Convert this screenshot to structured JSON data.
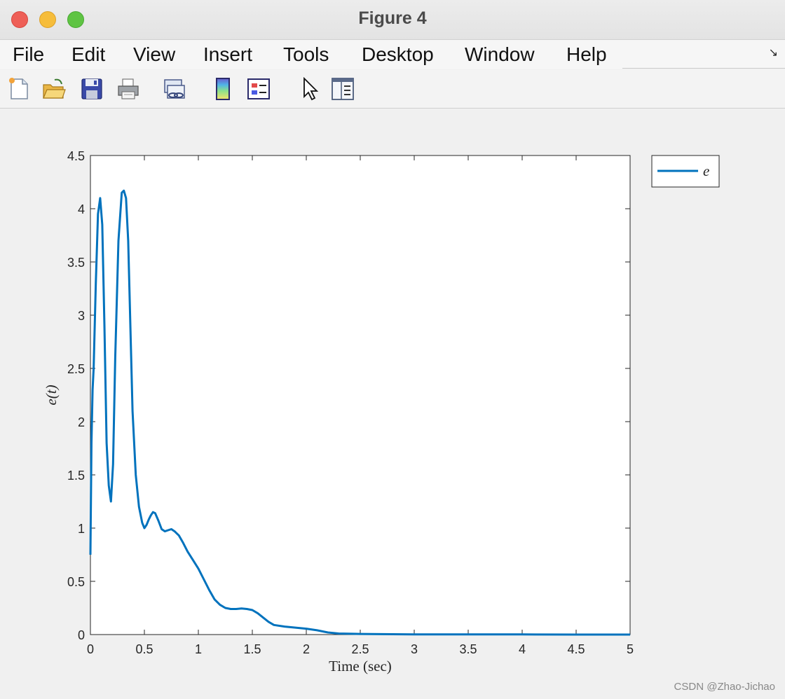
{
  "window": {
    "title": "Figure 4"
  },
  "menu": {
    "items": [
      {
        "label": "File",
        "x": 18
      },
      {
        "label": "Edit",
        "x": 102
      },
      {
        "label": "View",
        "x": 190
      },
      {
        "label": "Insert",
        "x": 290
      },
      {
        "label": "Tools",
        "x": 404
      },
      {
        "label": "Desktop",
        "x": 516
      },
      {
        "label": "Window",
        "x": 663
      },
      {
        "label": "Help",
        "x": 808
      }
    ]
  },
  "toolbar": {
    "buttons": [
      {
        "name": "new-figure-icon",
        "x": 10
      },
      {
        "name": "open-file-icon",
        "x": 60
      },
      {
        "name": "save-icon",
        "x": 114
      },
      {
        "name": "print-icon",
        "x": 166
      },
      {
        "name": "link-plot-icon",
        "x": 232
      },
      {
        "name": "insert-colorbar-icon",
        "x": 302
      },
      {
        "name": "insert-legend-icon",
        "x": 352
      },
      {
        "name": "edit-plot-pointer-icon",
        "x": 426
      },
      {
        "name": "property-inspector-icon",
        "x": 472
      }
    ]
  },
  "watermark": "CSDN @Zhao-Jichao",
  "chart_data": {
    "type": "line",
    "title": "",
    "xlabel": "Time (sec)",
    "ylabel": "e(t)",
    "xlim": [
      0,
      5
    ],
    "ylim": [
      0,
      4.5
    ],
    "xticks": [
      0,
      0.5,
      1,
      1.5,
      2,
      2.5,
      3,
      3.5,
      4,
      4.5,
      5
    ],
    "xtick_labels": [
      "0",
      "0.5",
      "1",
      "1.5",
      "2",
      "2.5",
      "3",
      "3.5",
      "4",
      "4.5",
      "5"
    ],
    "yticks": [
      0,
      0.5,
      1,
      1.5,
      2,
      2.5,
      3,
      3.5,
      4,
      4.5
    ],
    "ytick_labels": [
      "0",
      "0.5",
      "1",
      "1.5",
      "2",
      "2.5",
      "3",
      "3.5",
      "4",
      "4.5"
    ],
    "grid": false,
    "legend": {
      "position": "outside-top-right",
      "entries": [
        "e"
      ]
    },
    "series": [
      {
        "name": "e",
        "color": "#0072BD",
        "x": [
          0,
          0.01,
          0.02,
          0.03,
          0.05,
          0.07,
          0.09,
          0.11,
          0.13,
          0.15,
          0.17,
          0.19,
          0.21,
          0.23,
          0.26,
          0.29,
          0.31,
          0.33,
          0.35,
          0.37,
          0.39,
          0.42,
          0.45,
          0.48,
          0.5,
          0.52,
          0.54,
          0.56,
          0.58,
          0.6,
          0.63,
          0.66,
          0.69,
          0.72,
          0.75,
          0.78,
          0.82,
          0.86,
          0.9,
          0.95,
          1.0,
          1.05,
          1.1,
          1.15,
          1.2,
          1.25,
          1.3,
          1.35,
          1.4,
          1.45,
          1.5,
          1.55,
          1.6,
          1.65,
          1.7,
          1.8,
          1.9,
          2.0,
          2.1,
          2.2,
          2.3,
          2.5,
          2.8,
          3.0,
          3.5,
          4.0,
          4.5,
          5.0
        ],
        "values": [
          0.75,
          1.8,
          2.3,
          2.5,
          3.3,
          3.95,
          4.1,
          3.85,
          2.9,
          1.8,
          1.4,
          1.25,
          1.6,
          2.6,
          3.7,
          4.15,
          4.17,
          4.1,
          3.7,
          2.9,
          2.1,
          1.5,
          1.2,
          1.05,
          1.0,
          1.03,
          1.08,
          1.12,
          1.15,
          1.14,
          1.07,
          0.99,
          0.97,
          0.98,
          0.99,
          0.97,
          0.93,
          0.86,
          0.78,
          0.7,
          0.62,
          0.52,
          0.42,
          0.33,
          0.28,
          0.25,
          0.24,
          0.24,
          0.245,
          0.24,
          0.23,
          0.2,
          0.16,
          0.12,
          0.09,
          0.075,
          0.065,
          0.055,
          0.04,
          0.02,
          0.01,
          0.006,
          0.003,
          0.002,
          0.001,
          0.001,
          0.0,
          0.0
        ]
      }
    ]
  }
}
